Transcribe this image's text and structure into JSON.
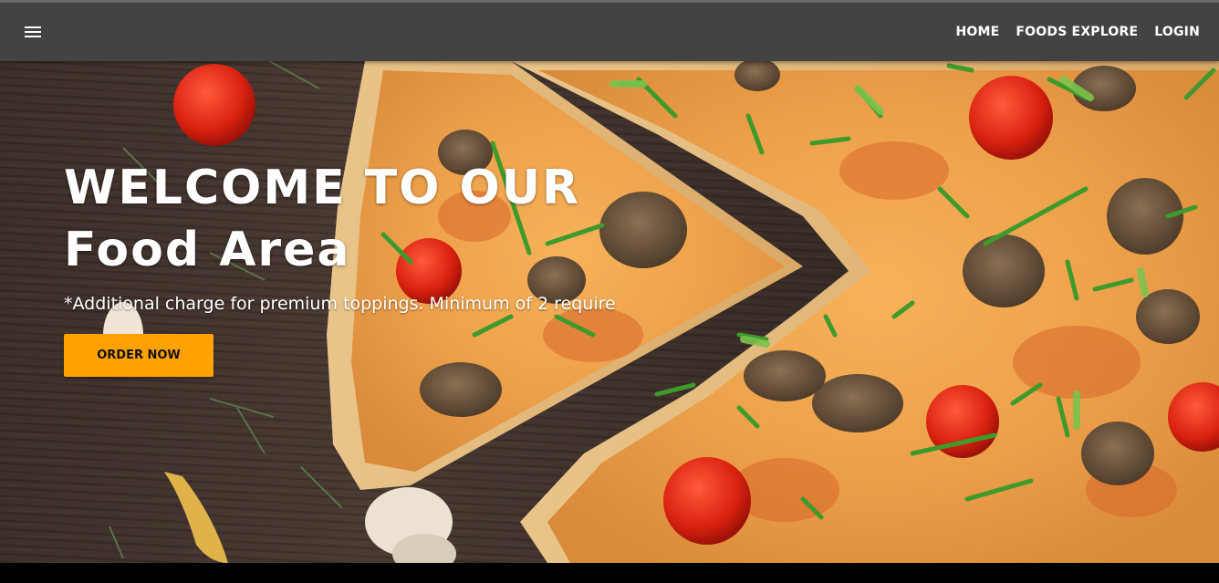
{
  "navbar": {
    "menu_icon": "hamburger-menu-icon",
    "links": [
      {
        "label": "HOME"
      },
      {
        "label": "FOODS EXPLORE"
      },
      {
        "label": "LOGIN"
      }
    ],
    "background": "#444343"
  },
  "hero": {
    "title_line1": "WELCOME TO OUR",
    "title_line2": "Food Area",
    "subtitle": "*Additional charge for premium toppings. Minimum of 2 require",
    "cta_label": "ORDER NOW",
    "cta_color": "#ffa200",
    "background_image": "pizza-on-wooden-table"
  }
}
